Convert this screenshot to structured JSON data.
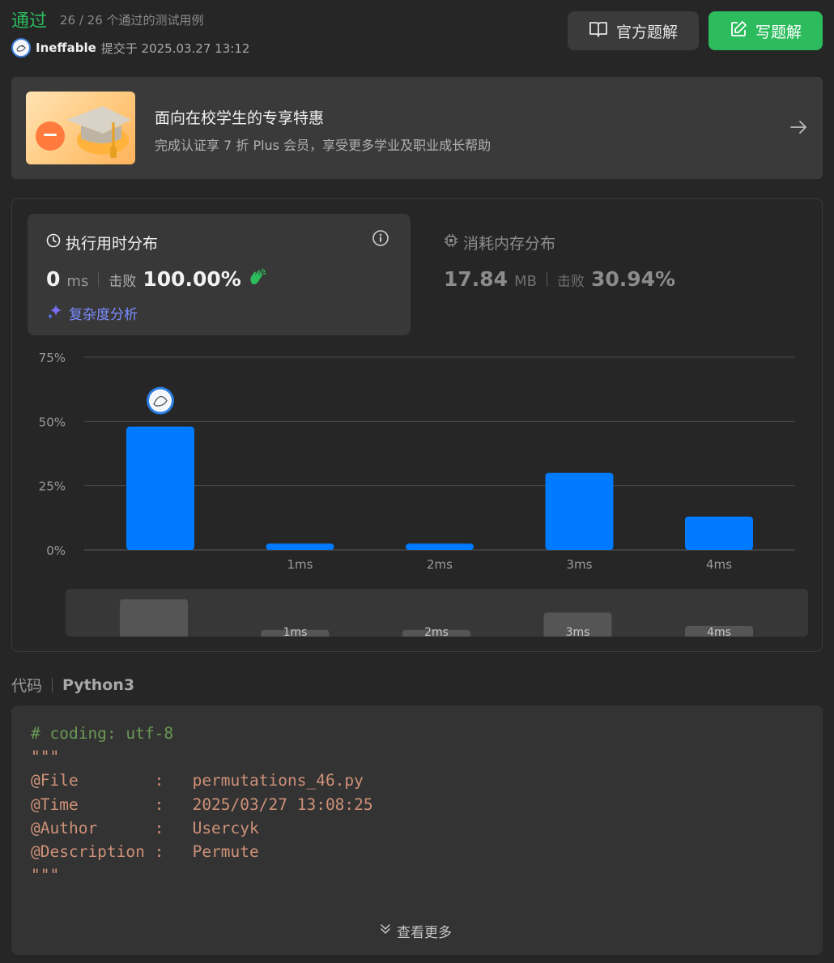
{
  "header": {
    "status": "通过",
    "tests_count": "26 / 26 个通过的测试用例",
    "username": "Ineffable",
    "submitted_at": "提交于 2025.03.27 13:12",
    "official_solution_label": "官方题解",
    "write_solution_label": "写题解"
  },
  "promo": {
    "title": "面向在校学生的专享特惠",
    "subtitle": "完成认证享 7 折 Plus 会员，享受更多学业及职业成长帮助"
  },
  "runtime": {
    "title": "执行用时分布",
    "value": "0",
    "unit": "ms",
    "beat_label": "击败",
    "beat_value": "100.00%",
    "complexity_label": "复杂度分析"
  },
  "memory": {
    "title": "消耗内存分布",
    "value": "17.84",
    "unit": "MB",
    "beat_label": "击败",
    "beat_value": "30.94%"
  },
  "chart_data": {
    "type": "bar",
    "categories": [
      "",
      "1ms",
      "2ms",
      "3ms",
      "4ms"
    ],
    "values": [
      48,
      2.5,
      2.5,
      30,
      13
    ],
    "yticks": [
      "75%",
      "50%",
      "25%",
      "0%"
    ],
    "ylim": [
      0,
      75
    ],
    "grid": true,
    "bar_color": "#007aff",
    "minimap_values": [
      28,
      5,
      5,
      18,
      8
    ],
    "minimap_labels": [
      "",
      "1ms",
      "2ms",
      "3ms",
      "4ms"
    ]
  },
  "code": {
    "label": "代码",
    "language": "Python3",
    "lines": [
      {
        "text": "# coding: utf-8",
        "cls": "c-comment"
      },
      {
        "text": "\"\"\"",
        "cls": "c-str"
      },
      {
        "text": "@File        :   permutations_46.py",
        "cls": "c-str"
      },
      {
        "text": "@Time        :   2025/03/27 13:08:25",
        "cls": "c-str"
      },
      {
        "text": "@Author      :   Usercyk",
        "cls": "c-str"
      },
      {
        "text": "@Description :   Permute",
        "cls": "c-str"
      },
      {
        "text": "\"\"\"",
        "cls": "c-str"
      }
    ],
    "see_more_label": "查看更多"
  },
  "colors": {
    "accent_green": "#2cbb5d",
    "bar_blue": "#007aff",
    "purple": "#7b8cff"
  }
}
